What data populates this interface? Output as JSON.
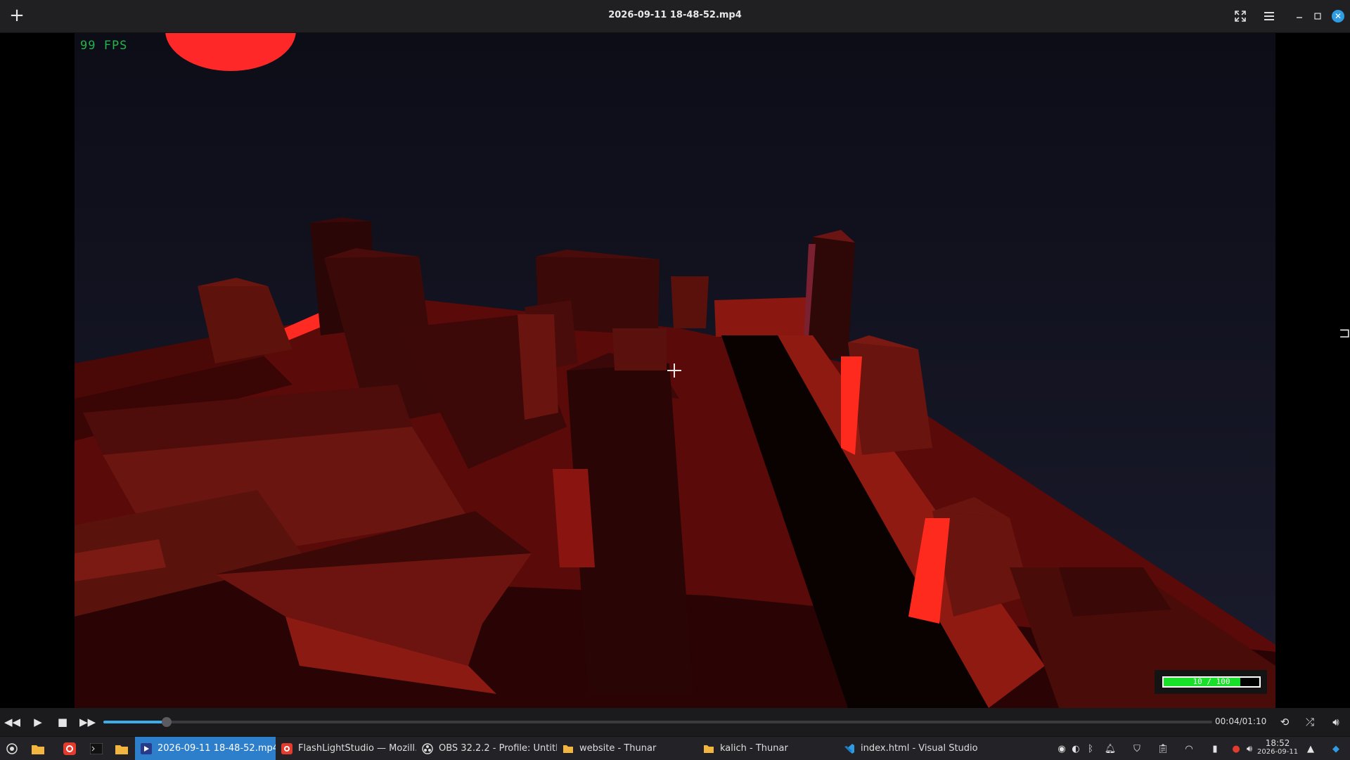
{
  "window": {
    "title": "2026-09-11 18-48-52.mp4",
    "add_icon": "plus-icon",
    "fullscreen_icon": "fullscreen-icon",
    "menu_icon": "hamburger-icon",
    "minimize_icon": "minimize-icon",
    "maximize_icon": "maximize-icon",
    "close_icon": "close-icon"
  },
  "video": {
    "fps_text": "99 FPS",
    "health_text": "10 / 100",
    "health_fraction": 0.8,
    "accent": "#19e028",
    "fps_color": "#22b34a"
  },
  "player": {
    "time_text": "00:04/01:10",
    "progress_fraction": 0.057,
    "accent": "#3daee9",
    "buttons": [
      "rewind-icon",
      "play-icon",
      "stop-icon",
      "fast-forward-icon",
      "repeat-icon",
      "shuffle-icon",
      "volume-icon"
    ]
  },
  "taskbar": {
    "tasks": [
      {
        "label": "2026-09-11 18-48-52.mp4",
        "icon": "video-player-icon",
        "active": true
      },
      {
        "label": "FlashLightStudio — Mozill…",
        "icon": "firefox-icon",
        "active": false
      },
      {
        "label": "OBS 32.2.2 - Profile: Untitl…",
        "icon": "obs-icon",
        "active": false
      },
      {
        "label": "website - Thunar",
        "icon": "folder-icon",
        "active": false
      },
      {
        "label": "kalich - Thunar",
        "icon": "folder-icon",
        "active": false
      },
      {
        "label": "index.html - Visual Studio …",
        "icon": "vscode-icon",
        "active": false
      }
    ],
    "clock_time": "18:52",
    "clock_date": "2026-09-11"
  }
}
